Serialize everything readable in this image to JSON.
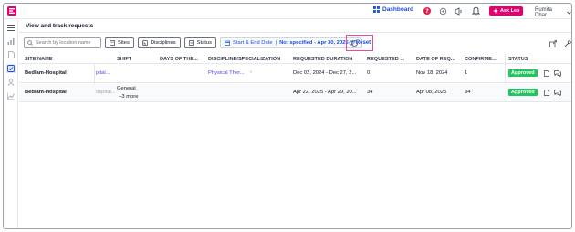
{
  "topbar": {
    "dashboard_label": "Dashboard",
    "ask_label": "Ask Leo",
    "user_name": "Rumita Dhar"
  },
  "page": {
    "title": "View and track requests"
  },
  "filters": {
    "search_placeholder": "Search by location name",
    "sites_label": "Sites",
    "disciplines_label": "Disciplines",
    "status_label": "Status",
    "date_label": "Start & End Date",
    "date_value": "Not specified - Apr 30, 2025",
    "reset_label": "Reset"
  },
  "table": {
    "headers": {
      "site": "SITE NAME",
      "shift": "SHIFT",
      "days": "DAYS OF THE...",
      "discipline": "DISCIPLINE/SPECIALIZATION",
      "duration": "REQUESTED DURATION",
      "requested": "REQUESTED ...",
      "date": "DATE OF REQ...",
      "confirmed": "CONFIRME...",
      "status": "STATUS"
    },
    "rows": [
      {
        "site": "Bedlam-Hospital",
        "frag": "pital...",
        "shift": "",
        "shift_more": "",
        "days": "",
        "discipline": "Physical Ther...",
        "duration": "Dec 02, 2024 - Dec 27, 2...",
        "requested": "0",
        "date": "Nov 18, 2024",
        "confirmed": "1",
        "status": "Approved"
      },
      {
        "site": "Bedlam-Hospital",
        "frag": "ospital...",
        "shift": "General",
        "shift_more": "+3 more",
        "days": "",
        "discipline": "",
        "duration": "Apr 22, 2025 - Apr 29, 20...",
        "requested": "34",
        "date": "Apr 08, 2025",
        "confirmed": "34",
        "status": "Approved"
      }
    ]
  },
  "colors": {
    "accent": "#1d4ed8",
    "brand": "#e6006e",
    "approved": "#22c55e",
    "reset_highlight": "#ec4899"
  }
}
